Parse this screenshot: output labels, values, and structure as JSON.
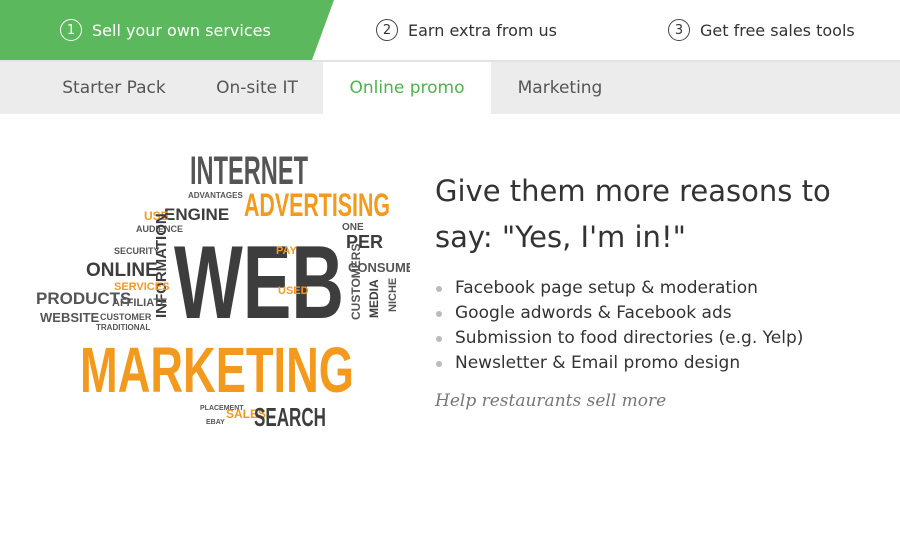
{
  "steps": [
    {
      "number": "1",
      "label": "Sell your own services",
      "active": true
    },
    {
      "number": "2",
      "label": "Earn extra from us",
      "active": false
    },
    {
      "number": "3",
      "label": "Get free sales tools",
      "active": false
    }
  ],
  "tabs": [
    {
      "label": "Starter Pack"
    },
    {
      "label": "On-site IT"
    },
    {
      "label": "Online promo"
    },
    {
      "label": "Marketing"
    }
  ],
  "colors": {
    "accent": "#5cb85c",
    "active_tab_text": "#4ab54a",
    "orange": "#f39a1d",
    "dark": "#3d3d3d"
  },
  "illustration": {
    "internet": "INTERNET",
    "advertising": "ADVERTISING",
    "web": "WEB",
    "marketing": "MARKETING",
    "search": "SEARCH",
    "online": "ONLINE",
    "products": "PRODUCTS",
    "website": "WEBSITE",
    "engine": "ENGINE",
    "information": "INFORMATION",
    "consumer": "CONSUMER",
    "per": "PER",
    "pay": "PAY",
    "services": "SERVICES",
    "affiliate": "AFFILIATE",
    "customer": "CUSTOMER",
    "traditional": "TRADITIONAL",
    "media": "MEDIA",
    "customers": "CUSTOMERS",
    "niche": "NICHE",
    "sales": "SALES",
    "advantages": "ADVANTAGES",
    "audience": "AUDIENCE",
    "use": "USE",
    "security": "SECURITY",
    "used": "USED",
    "placement": "PLACEMENT",
    "ebay": "EBAY",
    "one": "ONE"
  },
  "heading": "Give them more reasons to say: \"Yes, I'm in!\"",
  "features": [
    "Facebook page setup & moderation",
    "Google adwords & Facebook ads",
    "Submission to food directories (e.g. Yelp)",
    "Newsletter & Email promo design"
  ],
  "tagline": "Help restaurants sell more"
}
